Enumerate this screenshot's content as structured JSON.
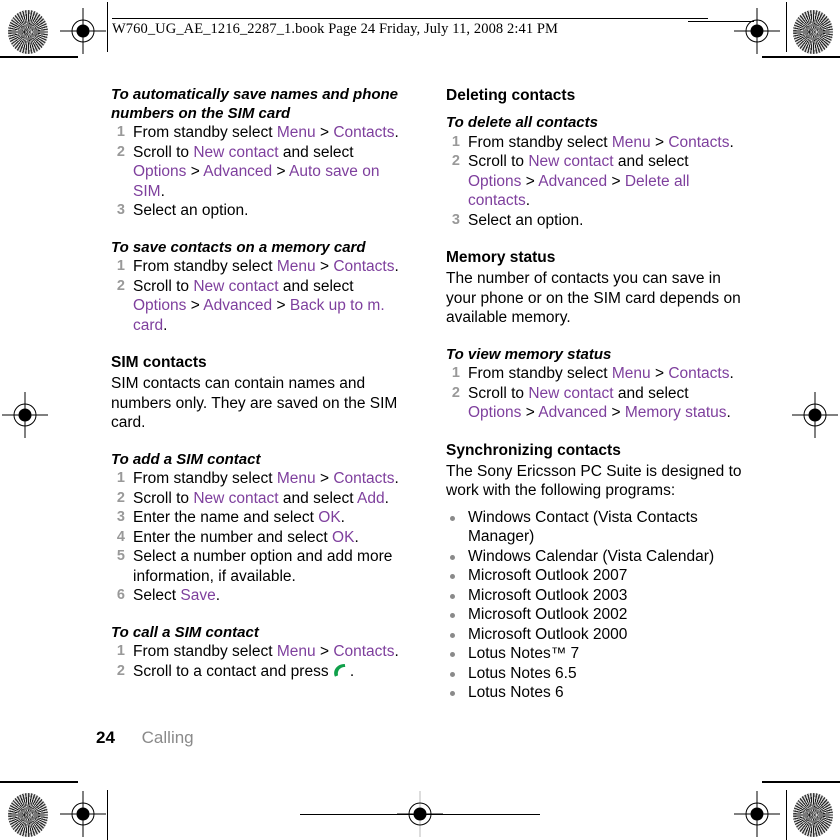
{
  "header": {
    "text": "W760_UG_AE_1216_2287_1.book  Page 24  Friday, July 11, 2008  2:41 PM"
  },
  "colors": {
    "link": "#7e3f9d",
    "step_number": "#999999",
    "bullet": "#8a8a8a",
    "call_icon": "#10a04a",
    "body_text": "#000000"
  },
  "left_column": {
    "proc_auto_save": {
      "heading": "To automatically save names and phone numbers on the SIM card",
      "steps": [
        {
          "num": "1",
          "parts": [
            {
              "t": "From standby select ",
              "s": "plain"
            },
            {
              "t": "Menu",
              "s": "link"
            },
            {
              "t": " > ",
              "s": "sep"
            },
            {
              "t": "Contacts",
              "s": "link"
            },
            {
              "t": ".",
              "s": "plain"
            }
          ]
        },
        {
          "num": "2",
          "parts": [
            {
              "t": "Scroll to ",
              "s": "plain"
            },
            {
              "t": "New contact",
              "s": "link"
            },
            {
              "t": " and select ",
              "s": "plain"
            },
            {
              "t": "Options",
              "s": "link"
            },
            {
              "t": " > ",
              "s": "sep"
            },
            {
              "t": "Advanced",
              "s": "link"
            },
            {
              "t": " > ",
              "s": "sep"
            },
            {
              "t": "Auto save on SIM",
              "s": "link"
            },
            {
              "t": ".",
              "s": "plain"
            }
          ]
        },
        {
          "num": "3",
          "parts": [
            {
              "t": "Select an option.",
              "s": "plain"
            }
          ]
        }
      ]
    },
    "proc_memory_card": {
      "heading": "To save contacts on a memory card",
      "steps": [
        {
          "num": "1",
          "parts": [
            {
              "t": "From standby select ",
              "s": "plain"
            },
            {
              "t": "Menu",
              "s": "link"
            },
            {
              "t": " > ",
              "s": "sep"
            },
            {
              "t": "Contacts",
              "s": "link"
            },
            {
              "t": ".",
              "s": "plain"
            }
          ]
        },
        {
          "num": "2",
          "parts": [
            {
              "t": "Scroll to ",
              "s": "plain"
            },
            {
              "t": "New contact",
              "s": "link"
            },
            {
              "t": " and select ",
              "s": "plain"
            },
            {
              "t": "Options",
              "s": "link"
            },
            {
              "t": " > ",
              "s": "sep"
            },
            {
              "t": "Advanced",
              "s": "link"
            },
            {
              "t": " > ",
              "s": "sep"
            },
            {
              "t": "Back up to m. card",
              "s": "link"
            },
            {
              "t": ".",
              "s": "plain"
            }
          ]
        }
      ]
    },
    "sim_contacts": {
      "heading": "SIM contacts",
      "body": "SIM contacts can contain names and numbers only. They are saved on the SIM card."
    },
    "proc_add_sim": {
      "heading": "To add a SIM contact",
      "steps": [
        {
          "num": "1",
          "parts": [
            {
              "t": "From standby select ",
              "s": "plain"
            },
            {
              "t": "Menu",
              "s": "link"
            },
            {
              "t": " > ",
              "s": "sep"
            },
            {
              "t": "Contacts",
              "s": "link"
            },
            {
              "t": ".",
              "s": "plain"
            }
          ]
        },
        {
          "num": "2",
          "parts": [
            {
              "t": "Scroll to ",
              "s": "plain"
            },
            {
              "t": "New contact",
              "s": "link"
            },
            {
              "t": " and select ",
              "s": "plain"
            },
            {
              "t": "Add",
              "s": "link"
            },
            {
              "t": ".",
              "s": "plain"
            }
          ]
        },
        {
          "num": "3",
          "parts": [
            {
              "t": "Enter the name and select ",
              "s": "plain"
            },
            {
              "t": "OK",
              "s": "link"
            },
            {
              "t": ".",
              "s": "plain"
            }
          ]
        },
        {
          "num": "4",
          "parts": [
            {
              "t": "Enter the number and select ",
              "s": "plain"
            },
            {
              "t": "OK",
              "s": "link"
            },
            {
              "t": ".",
              "s": "plain"
            }
          ]
        },
        {
          "num": "5",
          "parts": [
            {
              "t": "Select a number option and add more information, if available.",
              "s": "plain"
            }
          ]
        },
        {
          "num": "6",
          "parts": [
            {
              "t": "Select ",
              "s": "plain"
            },
            {
              "t": "Save",
              "s": "link"
            },
            {
              "t": ".",
              "s": "plain"
            }
          ]
        }
      ]
    },
    "proc_call_sim": {
      "heading": "To call a SIM contact",
      "steps": [
        {
          "num": "1",
          "parts": [
            {
              "t": "From standby select ",
              "s": "plain"
            },
            {
              "t": "Menu",
              "s": "link"
            },
            {
              "t": " > ",
              "s": "sep"
            },
            {
              "t": "Contacts",
              "s": "link"
            },
            {
              "t": ".",
              "s": "plain"
            }
          ]
        },
        {
          "num": "2",
          "parts": [
            {
              "t": "Scroll to a contact and press ",
              "s": "plain"
            },
            {
              "t": "call-icon",
              "s": "icon"
            },
            {
              "t": ".",
              "s": "plain"
            }
          ]
        }
      ]
    }
  },
  "right_column": {
    "deleting_contacts": {
      "heading": "Deleting contacts"
    },
    "proc_delete_all": {
      "heading": "To delete all contacts",
      "steps": [
        {
          "num": "1",
          "parts": [
            {
              "t": "From standby select ",
              "s": "plain"
            },
            {
              "t": "Menu",
              "s": "link"
            },
            {
              "t": " > ",
              "s": "sep"
            },
            {
              "t": "Contacts",
              "s": "link"
            },
            {
              "t": ".",
              "s": "plain"
            }
          ]
        },
        {
          "num": "2",
          "parts": [
            {
              "t": "Scroll to ",
              "s": "plain"
            },
            {
              "t": "New contact",
              "s": "link"
            },
            {
              "t": " and select ",
              "s": "plain"
            },
            {
              "t": "Options",
              "s": "link"
            },
            {
              "t": " > ",
              "s": "sep"
            },
            {
              "t": "Advanced",
              "s": "link"
            },
            {
              "t": " > ",
              "s": "sep"
            },
            {
              "t": "Delete all contacts",
              "s": "link"
            },
            {
              "t": ".",
              "s": "plain"
            }
          ]
        },
        {
          "num": "3",
          "parts": [
            {
              "t": "Select an option.",
              "s": "plain"
            }
          ]
        }
      ]
    },
    "memory_status": {
      "heading": "Memory status",
      "body": "The number of contacts you can save in your phone or on the SIM card depends on available memory."
    },
    "proc_view_memory": {
      "heading": "To view memory status",
      "steps": [
        {
          "num": "1",
          "parts": [
            {
              "t": "From standby select ",
              "s": "plain"
            },
            {
              "t": "Menu",
              "s": "link"
            },
            {
              "t": " > ",
              "s": "sep"
            },
            {
              "t": "Contacts",
              "s": "link"
            },
            {
              "t": ".",
              "s": "plain"
            }
          ]
        },
        {
          "num": "2",
          "parts": [
            {
              "t": "Scroll to ",
              "s": "plain"
            },
            {
              "t": "New contact",
              "s": "link"
            },
            {
              "t": " and select ",
              "s": "plain"
            },
            {
              "t": "Options",
              "s": "link"
            },
            {
              "t": " > ",
              "s": "sep"
            },
            {
              "t": "Advanced",
              "s": "link"
            },
            {
              "t": " > ",
              "s": "sep"
            },
            {
              "t": "Memory status",
              "s": "link"
            },
            {
              "t": ".",
              "s": "plain"
            }
          ]
        }
      ]
    },
    "synchronizing": {
      "heading": "Synchronizing contacts",
      "body": "The Sony Ericsson PC Suite is designed to work with the following programs:",
      "programs": [
        "Windows Contact (Vista Contacts Manager)",
        "Windows Calendar (Vista Calendar)",
        "Microsoft Outlook 2007",
        "Microsoft Outlook 2003",
        "Microsoft Outlook 2002",
        "Microsoft Outlook 2000",
        "Lotus Notes™ 7",
        "Lotus Notes 6.5",
        "Lotus Notes 6"
      ]
    }
  },
  "footer": {
    "page_number": "24",
    "chapter": "Calling"
  }
}
